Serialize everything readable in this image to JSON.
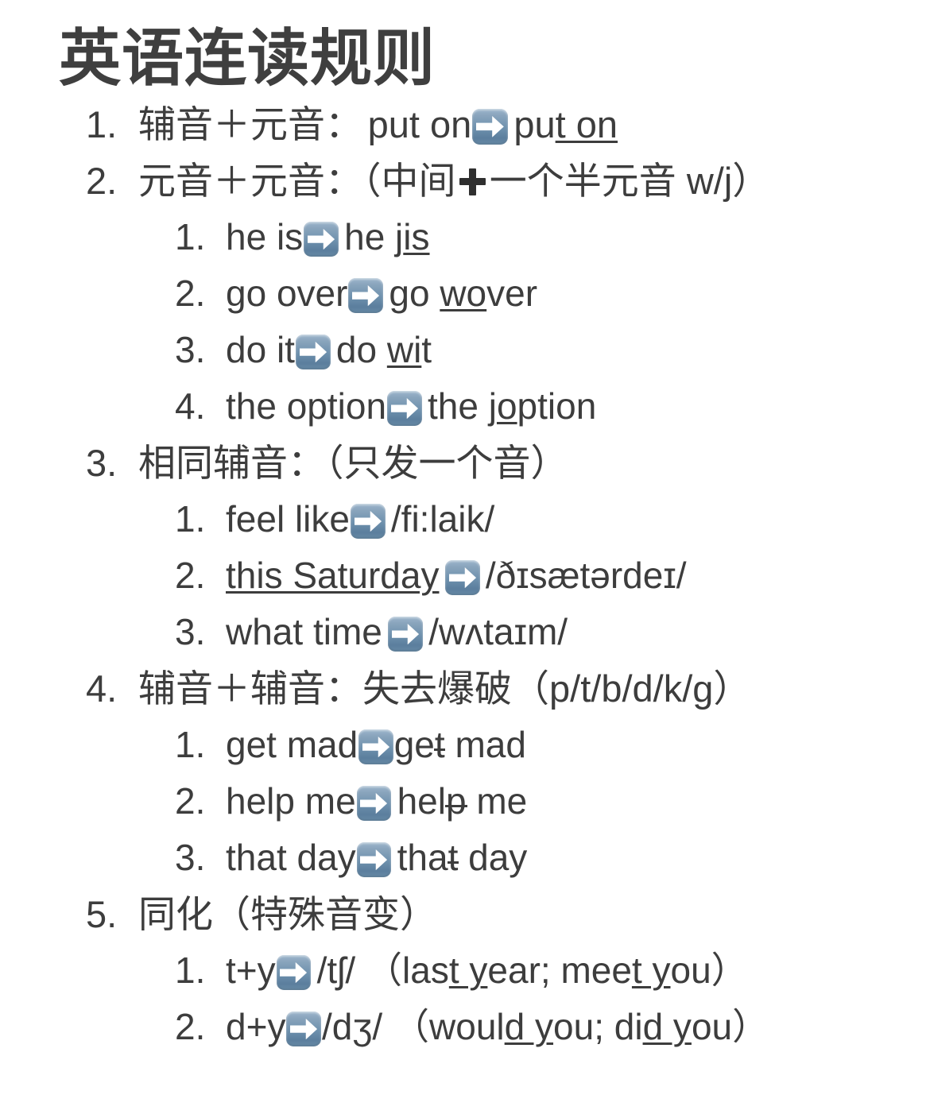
{
  "document": {
    "title": "英语连读规则",
    "background_color": "#ffffff",
    "text_color": "#3d3d3d",
    "icons": {
      "arrow": "right-arrow-emoji",
      "plus": "heavy-plus-emoji"
    },
    "accent_color": "#6d90ad"
  },
  "rules": [
    {
      "number": "1.",
      "heading_cn": "辅音＋元音：",
      "example_before": "put on",
      "example_after_plain": "pu",
      "example_after_underlined": "t on",
      "children": []
    },
    {
      "number": "2.",
      "heading_cn": "元音＋元音：（中间",
      "heading_cn_tail": "一个半元音 w/j）",
      "children": [
        {
          "number": "1.",
          "before": "he is",
          "after_plain": "he j",
          "after_underlined": "is",
          "after_tail": ""
        },
        {
          "number": "2.",
          "before": "go over",
          "after_plain": "go ",
          "after_underlined": "wo",
          "after_tail": "ver"
        },
        {
          "number": "3.",
          "before": "do it",
          "after_plain": "do ",
          "after_underlined": "wi",
          "after_tail": "t"
        },
        {
          "number": "4.",
          "before": "the option",
          "after_plain": "the j",
          "after_underlined": "o",
          "after_tail": "ption"
        }
      ]
    },
    {
      "number": "3.",
      "heading_cn": "相同辅音：（只发一个音）",
      "children": [
        {
          "number": "1.",
          "before_plain": "feel like",
          "before_underlined": "",
          "after": "/fi:laik/"
        },
        {
          "number": "2.",
          "before_plain": "",
          "before_underlined": "this Saturday",
          "after": "/ðɪsætərdeɪ/"
        },
        {
          "number": "3.",
          "before_plain": "what time",
          "before_underlined": "",
          "after": "/wʌtaɪm/"
        }
      ]
    },
    {
      "number": "4.",
      "heading_cn": "辅音＋辅音：失去爆破（p/t/b/d/k/g）",
      "children": [
        {
          "number": "1.",
          "before": "get mad",
          "after_pre": "ge",
          "after_struck": "t",
          "after_post": " mad"
        },
        {
          "number": "2.",
          "before": "help me",
          "after_pre": "hel",
          "after_struck": "p",
          "after_post": " me"
        },
        {
          "number": "3.",
          "before": "that day",
          "after_pre": "tha",
          "after_struck": "t",
          "after_post": " day"
        }
      ]
    },
    {
      "number": "5.",
      "heading_cn": "同化（特殊音变）",
      "children": [
        {
          "number": "1.",
          "before": "t+y",
          "phoneme": "/tʃ/",
          "note_open": "（las",
          "note_u1": "t y",
          "note_mid": "ear; mee",
          "note_u2": "t y",
          "note_close": "ou）"
        },
        {
          "number": "2.",
          "before": "d+y",
          "phoneme": "/dʒ/",
          "note_open": "（woul",
          "note_u1": "d y",
          "note_mid": "ou; di",
          "note_u2": "d y",
          "note_close": "ou）"
        }
      ]
    }
  ]
}
